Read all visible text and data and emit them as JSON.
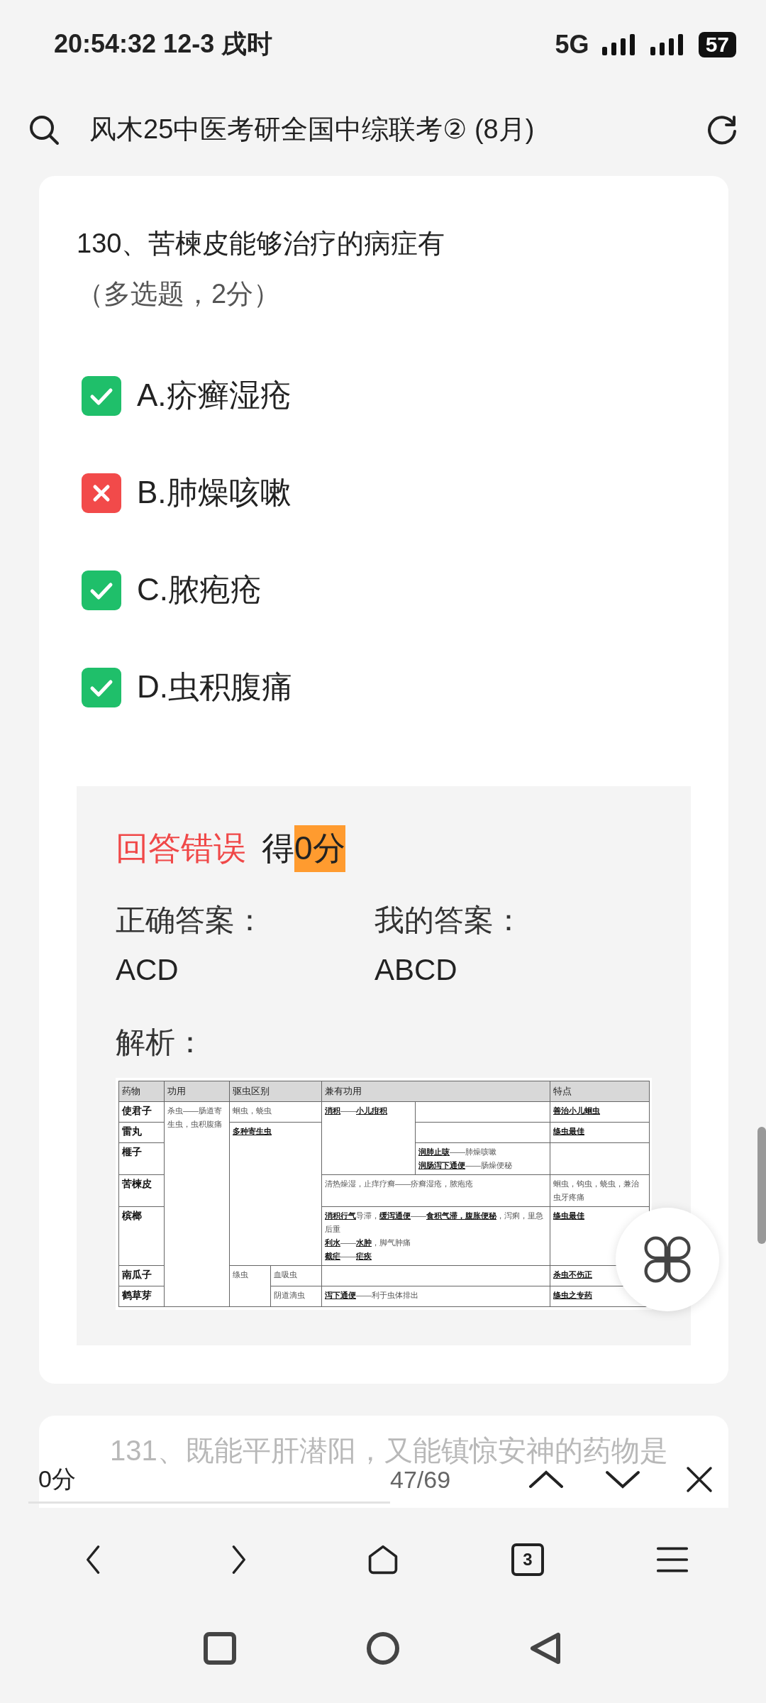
{
  "status_bar": {
    "time": "20:54:32 12-3 戌时",
    "network": "5G",
    "battery": "57"
  },
  "header": {
    "title": "风木25中医考研全国中综联考② (8月)"
  },
  "question": {
    "title": "130、苦楝皮能够治疗的病症有",
    "type_note": "（多选题，2分）",
    "options": [
      {
        "label": "A.疥癣湿疮",
        "correct": true
      },
      {
        "label": "B.肺燥咳嗽",
        "correct": false
      },
      {
        "label": "C.脓疱疮",
        "correct": true
      },
      {
        "label": "D.虫积腹痛",
        "correct": true
      }
    ]
  },
  "result": {
    "status": "回答错误",
    "score_prefix": "得",
    "score": "0分",
    "correct_label": "正确答案：",
    "correct_answer": "ACD",
    "my_label": "我的答案：",
    "my_answer": "ABCD",
    "analysis_label": "解析："
  },
  "analysis_table": {
    "header": [
      {
        "text": "药物"
      },
      {
        "text": "功用"
      },
      {
        "text": "驱虫区别",
        "colspan": 2
      },
      {
        "text": "兼有功用",
        "colspan": 2
      },
      {
        "text": "特点"
      }
    ],
    "rows": [
      {
        "cells": [
          {
            "kind": "drug",
            "lines": [
              "使君子"
            ]
          },
          {
            "lines": [
              "杀虫——肠道寄生虫，虫积腹痛"
            ],
            "rowspan": 7
          },
          {
            "lines": [
              "蛔虫，蛲虫"
            ],
            "colspan": 2
          },
          {
            "lines": [
              "**消积**——**小儿疳积**"
            ],
            "rowspan": 3
          },
          {},
          {
            "lines": [
              "**善治小儿蛔虫**"
            ]
          }
        ]
      },
      {
        "cells": [
          {
            "kind": "drug",
            "lines": [
              "雷丸"
            ]
          },
          {
            "lines": [
              "**多种寄生虫**"
            ],
            "colspan": 2,
            "rowspan": 4
          },
          {},
          {
            "lines": [
              "**绦虫最佳**"
            ]
          }
        ]
      },
      {
        "cells": [
          {
            "kind": "drug",
            "lines": [
              "榧子"
            ]
          },
          {
            "lines": [
              "**润肺止咳**——肺燥咳嗽",
              "**润肠泻下通便**——肠燥便秘"
            ]
          },
          {}
        ]
      },
      {
        "cells": [
          {
            "kind": "drug",
            "lines": [
              "苦楝皮"
            ]
          },
          {
            "lines": [
              "清热燥湿，止痒疗癣——疥癣湿疮，脓疱疮"
            ],
            "colspan": 2
          },
          {
            "lines": [
              "蛔虫，钩虫，蛲虫，兼治虫牙疼痛"
            ]
          }
        ]
      },
      {
        "cells": [
          {
            "kind": "drug",
            "lines": [
              "槟榔"
            ]
          },
          {
            "lines": [
              "**消积行气**导滞，**缓泻通便**——**食积气滞，腹胀便秘**，泻痢，里急后重",
              "**利水**——**水肿**，脚气肿痛",
              "**截疟**——**疟疾**"
            ],
            "colspan": 2
          },
          {
            "lines": [
              "**绦虫最佳**"
            ]
          }
        ]
      },
      {
        "cells": [
          {
            "kind": "drug",
            "lines": [
              "南瓜子"
            ]
          },
          {
            "lines": [
              "绦虫"
            ],
            "rowspan": 2
          },
          {
            "lines": [
              "血吸虫"
            ]
          },
          {
            "colspan": 2
          },
          {
            "lines": [
              "**杀虫不伤正**"
            ]
          }
        ]
      },
      {
        "cells": [
          {
            "kind": "drug",
            "lines": [
              "鹤草芽"
            ]
          },
          {
            "lines": [
              "阴道滴虫"
            ]
          },
          {
            "lines": [
              "**泻下通便**——利于虫体排出"
            ],
            "colspan": 2
          },
          {
            "lines": [
              "**绦虫之专药**"
            ]
          }
        ]
      }
    ]
  },
  "next_question": {
    "title": "131、既能平肝潜阳，又能镇惊安神的药物是"
  },
  "find_bar": {
    "value": "0分",
    "count": "47/69"
  },
  "tab_count": "3"
}
